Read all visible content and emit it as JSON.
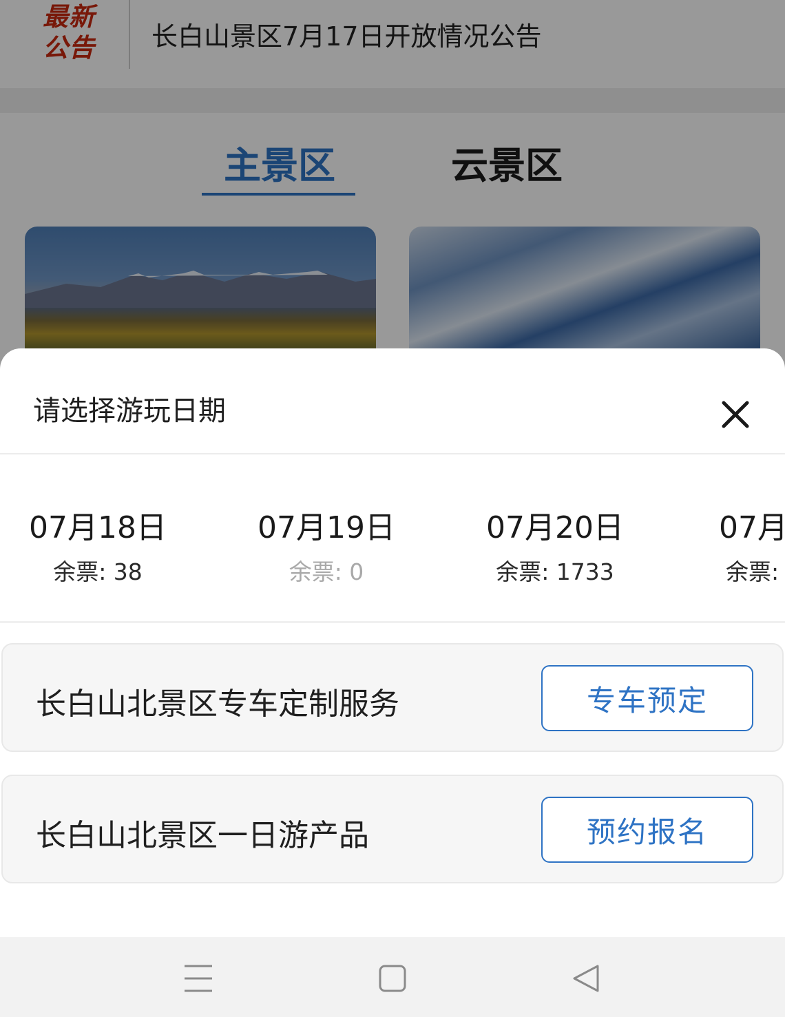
{
  "notice": {
    "logo_line1": "最新",
    "logo_line2": "公告",
    "text": "长白山景区7月17日开放情况公告"
  },
  "tabs": {
    "main": "主景区",
    "cloud": "云景区"
  },
  "sheet": {
    "title": "请选择游玩日期",
    "dates": [
      {
        "date": "07月18日",
        "ticket": "余票: 38"
      },
      {
        "date": "07月19日",
        "ticket": "余票: 0"
      },
      {
        "date": "07月20日",
        "ticket": "余票: 1733"
      },
      {
        "date": "07月",
        "ticket": "余票:"
      }
    ],
    "services": [
      {
        "name": "长白山北景区专车定制服务",
        "button": "专车预定"
      },
      {
        "name": "长白山北景区一日游产品",
        "button": "预约报名"
      }
    ]
  },
  "colors": {
    "accent": "#2e73c4",
    "notice_logo": "#c8290f",
    "disabled_text": "#a9a9a9"
  },
  "icons": {
    "close": "close-icon",
    "nav_menu": "menu-icon",
    "nav_home": "home-square-icon",
    "nav_back": "back-triangle-icon"
  }
}
